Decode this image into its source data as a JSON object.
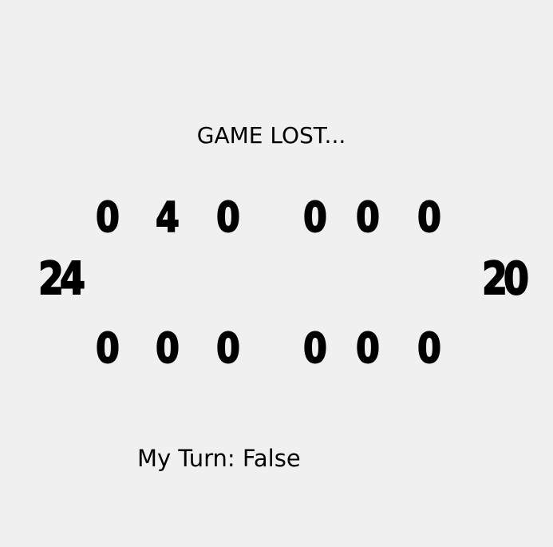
{
  "status": "GAME LOST...",
  "board": {
    "top_row": [
      "0",
      "4",
      "0",
      "0",
      "0",
      "0"
    ],
    "bottom_row": [
      "0",
      "0",
      "0",
      "0",
      "0",
      "0"
    ],
    "left_store": "24",
    "right_store": "20"
  },
  "turn_label": "My Turn: False"
}
